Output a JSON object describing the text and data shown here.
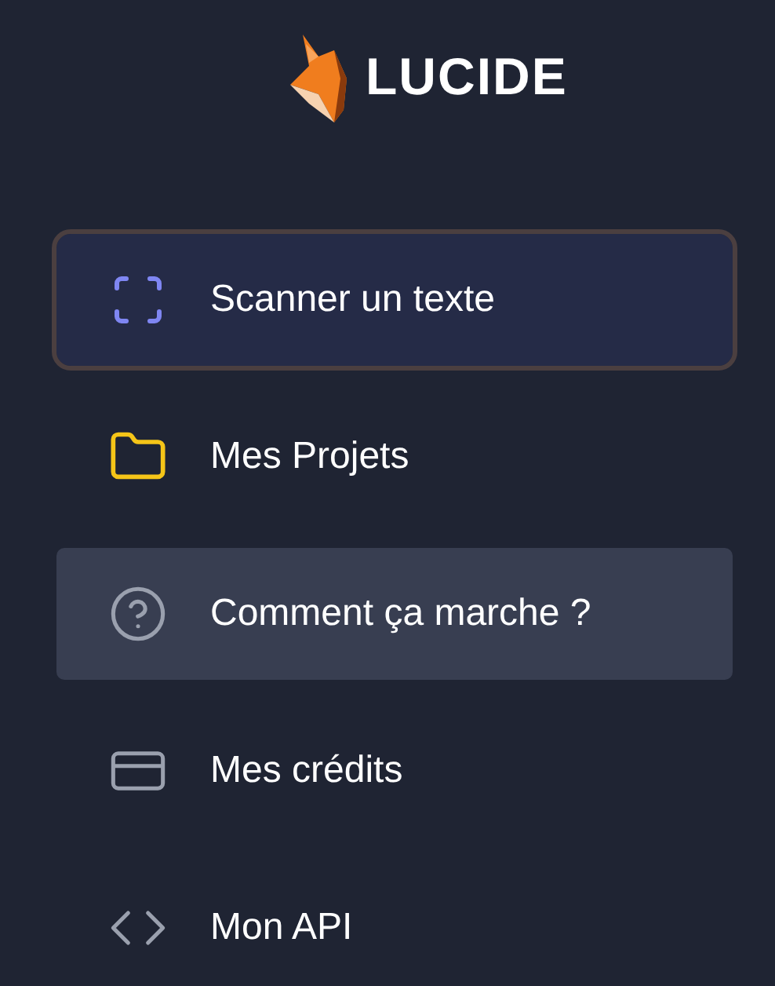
{
  "brand": {
    "name": "LUCIDE"
  },
  "menu": [
    {
      "kind": "scan",
      "label": "Scanner un texte",
      "selected": true,
      "hovered": false
    },
    {
      "kind": "folder",
      "label": "Mes Projets",
      "selected": false,
      "hovered": false
    },
    {
      "kind": "help",
      "label": "Comment ça marche ?",
      "selected": false,
      "hovered": true
    },
    {
      "kind": "card",
      "label": "Mes crédits",
      "selected": false,
      "hovered": false
    },
    {
      "kind": "code",
      "label": "Mon API",
      "selected": false,
      "hovered": false
    }
  ]
}
